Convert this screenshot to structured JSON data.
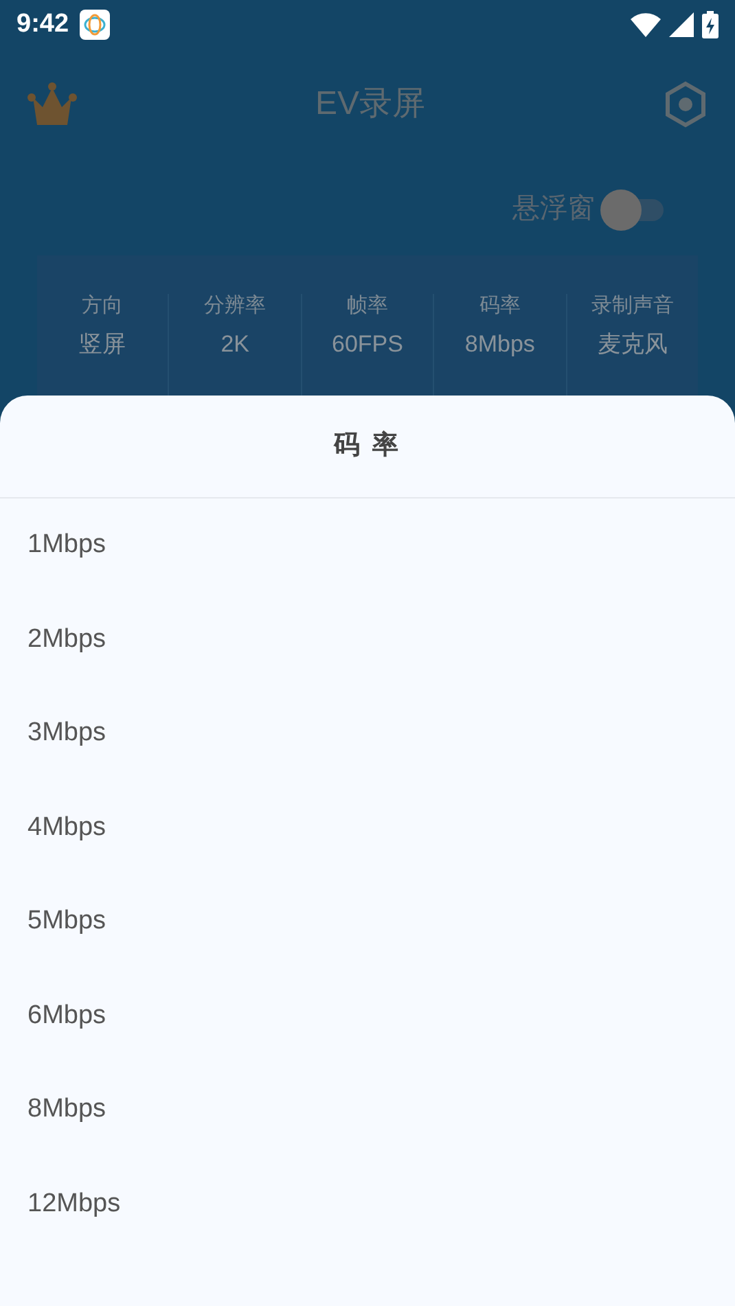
{
  "status_bar": {
    "time": "9:42"
  },
  "app_bar": {
    "title": "EV录屏"
  },
  "floating_window": {
    "label": "悬浮窗",
    "on": false
  },
  "settings": [
    {
      "label": "方向",
      "value": "竖屏"
    },
    {
      "label": "分辨率",
      "value": "2K"
    },
    {
      "label": "帧率",
      "value": "60FPS"
    },
    {
      "label": "码率",
      "value": "8Mbps"
    },
    {
      "label": "录制声音",
      "value": "麦克风"
    }
  ],
  "sheet": {
    "title": "码 率",
    "options": [
      "1Mbps",
      "2Mbps",
      "3Mbps",
      "4Mbps",
      "5Mbps",
      "6Mbps",
      "8Mbps",
      "12Mbps"
    ]
  }
}
